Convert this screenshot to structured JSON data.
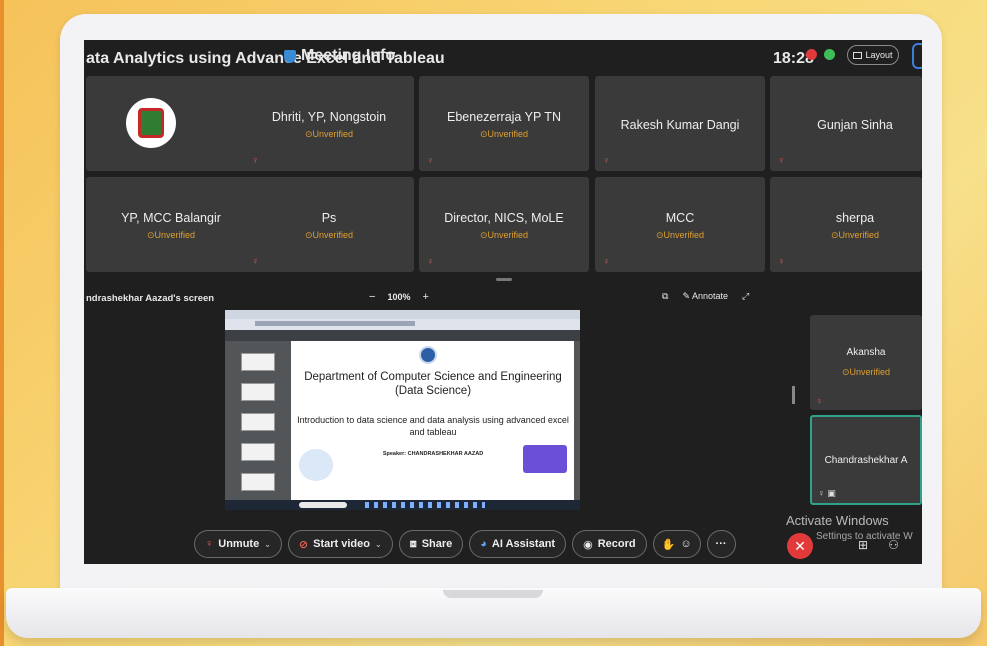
{
  "meeting": {
    "title": "ata Analytics using Advance Excel and Tableau",
    "info_label": "Meeting Info",
    "time": "18:28",
    "layout_label": "Layout"
  },
  "participants": [
    {
      "name": "",
      "status": "",
      "logo": true
    },
    {
      "name": "Dhriti, YP, Nongstoin",
      "status": "Unverified"
    },
    {
      "name": "Ebenezerraja YP TN",
      "status": "Unverified"
    },
    {
      "name": "Rakesh Kumar Dangi",
      "status": ""
    },
    {
      "name": "Gunjan Sinha",
      "status": ""
    },
    {
      "name": "YP, MCC Balangir",
      "status": "Unverified"
    },
    {
      "name": "Ps",
      "status": "Unverified"
    },
    {
      "name": "Director, NICS, MoLE",
      "status": "Unverified"
    },
    {
      "name": "MCC",
      "status": "Unverified"
    },
    {
      "name": "sherpa",
      "status": "Unverified"
    }
  ],
  "share": {
    "label": "ndrashekhar Aazad's screen",
    "zoom": "100%",
    "annotate_label": "Annotate"
  },
  "slide": {
    "department": "Department of Computer Science and Engineering (Data Science)",
    "intro": "Introduction to data science and data analysis using advanced excel and tableau",
    "speaker": "Speaker: CHANDRASHEKHAR AAZAD"
  },
  "side_tiles": [
    {
      "name": "Akansha",
      "status": "Unverified"
    },
    {
      "name": "Chandrashekhar A",
      "status": ""
    }
  ],
  "controls": {
    "unmute": "Unmute",
    "start_video": "Start video",
    "share": "Share",
    "ai_assistant": "AI Assistant",
    "record": "Record"
  },
  "watermark": {
    "line1": "Activate Windows",
    "line2": "Settings to activate W"
  },
  "icons": {
    "info": "shield-icon",
    "mic_muted": "mic-off-icon",
    "video_off": "video-off-icon",
    "share": "share-screen-icon",
    "ai": "ai-assistant-icon",
    "record": "record-icon",
    "end": "close-icon"
  },
  "colors": {
    "status_warning": "#e0a030",
    "end_call": "#e23a3a",
    "tile_bg": "#3a3a3a",
    "accent_green": "#2fa38a"
  }
}
